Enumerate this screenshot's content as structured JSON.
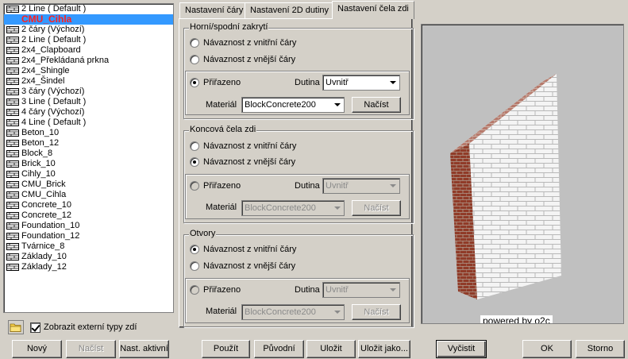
{
  "list": {
    "items": [
      {
        "label": "2 Line ( Default )",
        "selected": false
      },
      {
        "label": "CMU_Cihla",
        "selected": true
      },
      {
        "label": "2 čáry (Výchozí)",
        "selected": false
      },
      {
        "label": "2 Line ( Default )",
        "selected": false
      },
      {
        "label": "2x4_Clapboard",
        "selected": false
      },
      {
        "label": "2x4_Překládaná prkna",
        "selected": false
      },
      {
        "label": "2x4_Shingle",
        "selected": false
      },
      {
        "label": "2x4_Šindel",
        "selected": false
      },
      {
        "label": "3 čáry (Výchozí)",
        "selected": false
      },
      {
        "label": "3 Line ( Default )",
        "selected": false
      },
      {
        "label": "4 čáry (Výchozí)",
        "selected": false
      },
      {
        "label": "4 Line ( Default )",
        "selected": false
      },
      {
        "label": "Beton_10",
        "selected": false
      },
      {
        "label": "Beton_12",
        "selected": false
      },
      {
        "label": "Block_8",
        "selected": false
      },
      {
        "label": "Brick_10",
        "selected": false
      },
      {
        "label": "Cihly_10",
        "selected": false
      },
      {
        "label": "CMU_Brick",
        "selected": false
      },
      {
        "label": "CMU_Cihla",
        "selected": false
      },
      {
        "label": "Concrete_10",
        "selected": false
      },
      {
        "label": "Concrete_12",
        "selected": false
      },
      {
        "label": "Foundation_10",
        "selected": false
      },
      {
        "label": "Foundation_12",
        "selected": false
      },
      {
        "label": "Tvárnice_8",
        "selected": false
      },
      {
        "label": "Základy_10",
        "selected": false
      },
      {
        "label": "Základy_12",
        "selected": false
      }
    ],
    "show_external_label": "Zobrazit externí typy zdí"
  },
  "tabs": [
    {
      "label": "Nastavení čáry"
    },
    {
      "label": "Nastavení 2D dutiny"
    },
    {
      "label": "Nastavení čela zdi"
    }
  ],
  "groups": {
    "top": {
      "title": "Horní/spodní zakrytí",
      "opt1": "Návaznost z vnitřní čáry",
      "opt2": "Návaznost z vnější čáry",
      "opt3": "Přiřazeno",
      "dutina_label": "Dutina",
      "dutina_value": "Uvnitř",
      "material_label": "Materiál",
      "material_value": "BlockConcrete200",
      "load_label": "Načíst"
    },
    "end": {
      "title": "Koncová čela zdi",
      "opt1": "Návaznost z vnitřní čáry",
      "opt2": "Návaznost z vnější čáry",
      "opt3": "Přiřazeno",
      "dutina_label": "Dutina",
      "dutina_value": "Uvnitř",
      "material_label": "Materiál",
      "material_value": "BlockConcrete200",
      "load_label": "Načíst"
    },
    "openings": {
      "title": "Otvory",
      "opt1": "Návaznost z vnitřní čáry",
      "opt2": "Návaznost z vnější čáry",
      "opt3": "Přiřazeno",
      "dutina_label": "Dutina",
      "dutina_value": "Uvnitř",
      "material_label": "Materiál",
      "material_value": "BlockConcrete200",
      "load_label": "Načíst"
    }
  },
  "preview": {
    "powered": "powered by o2c"
  },
  "buttons": {
    "new": "Nový",
    "load": "Načíst",
    "active": "Nast. aktivní",
    "use": "Použít",
    "original": "Původní",
    "save": "Uložit",
    "save_as": "Uložit jako...",
    "clear": "Vyčistit",
    "ok": "OK",
    "cancel": "Storno"
  }
}
